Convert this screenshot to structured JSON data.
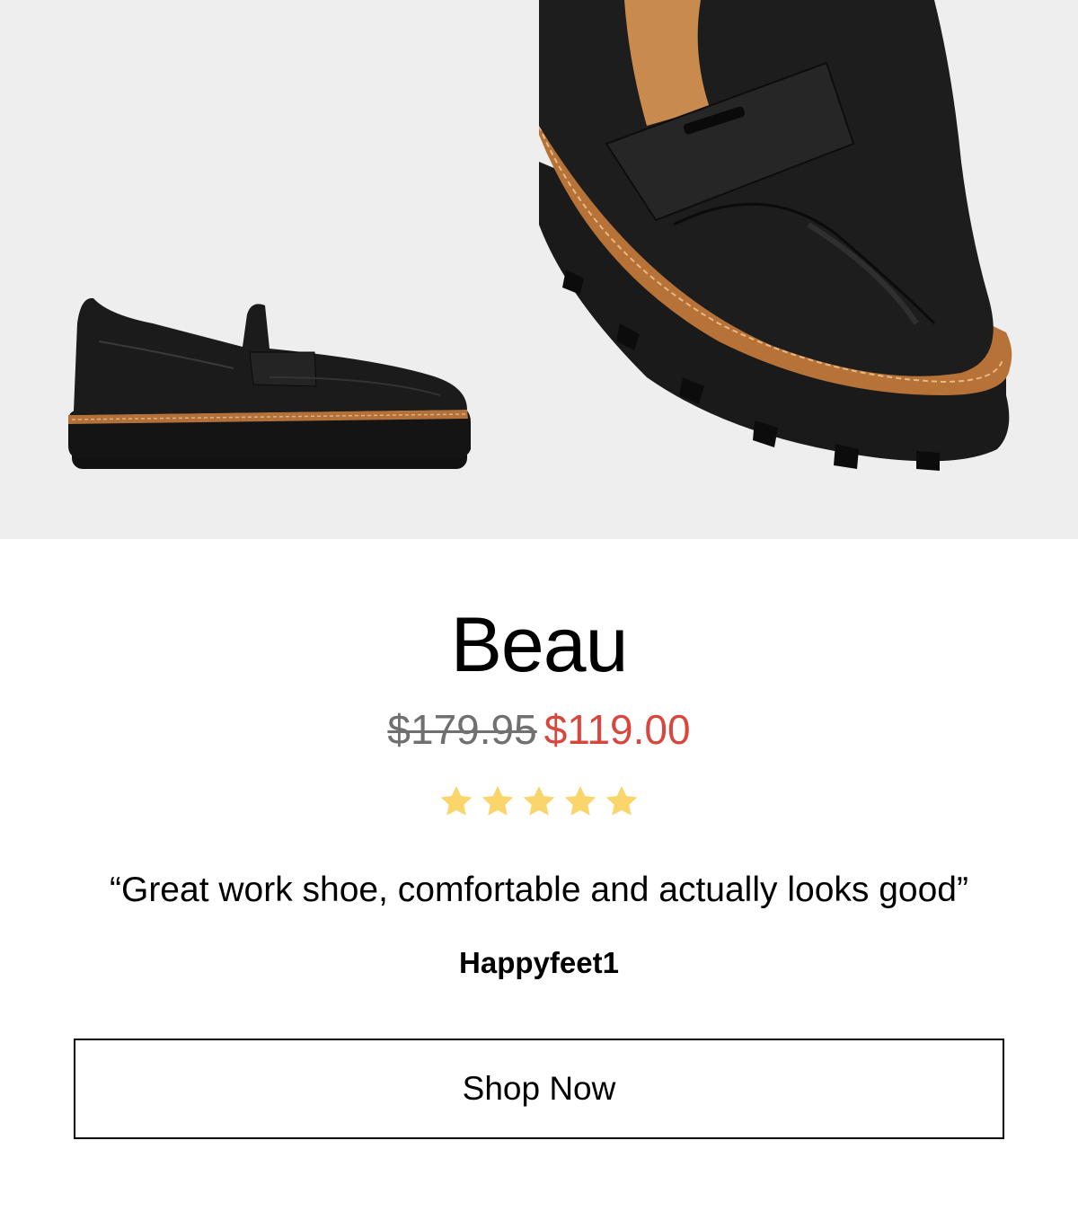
{
  "images": {
    "side_view": "loafer-side-view",
    "closeup": "loafer-toe-closeup"
  },
  "product": {
    "name": "Beau",
    "original_price": "$179.95",
    "sale_price": "$119.00",
    "rating": 5,
    "rating_max": 5
  },
  "review": {
    "quote": "“Great work shoe, comfortable and actually looks good”",
    "author": "Happyfeet1"
  },
  "cta": {
    "label": "Shop Now"
  },
  "colors": {
    "background": "#ffffff",
    "image_bg": "#eeeeee",
    "sale_price": "#d7473e",
    "original_price": "#707070",
    "star": "#f9d56b"
  }
}
